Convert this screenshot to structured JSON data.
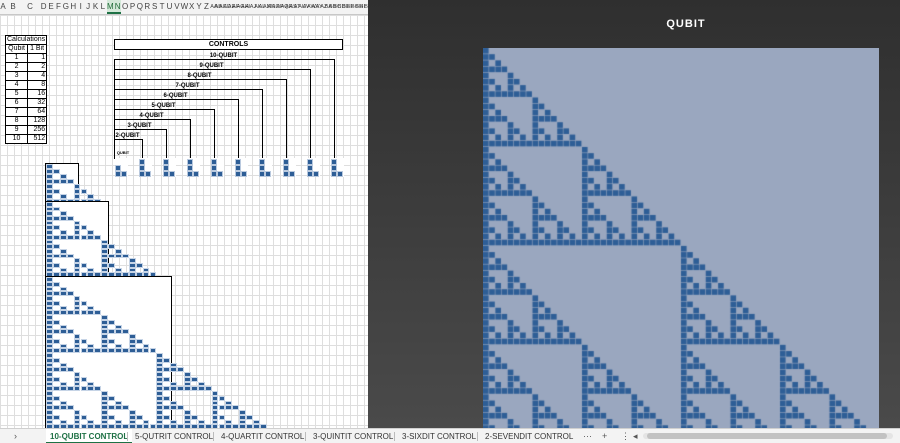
{
  "columns": [
    "A",
    "B",
    "C",
    "D",
    "E",
    "F",
    "G",
    "H",
    "I",
    "J",
    "K",
    "L",
    "M",
    "N",
    "O",
    "P",
    "Q",
    "R",
    "S",
    "T",
    "U",
    "V",
    "W",
    "X",
    "Y",
    "Z",
    "AA",
    "AB",
    "AC",
    "AD",
    "AE",
    "AF",
    "AG",
    "AH",
    "AI",
    "AJ",
    "AK",
    "AL",
    "AM",
    "AN",
    "AO",
    "AP",
    "AQ",
    "AR",
    "AS",
    "AT",
    "AU",
    "AV",
    "AW",
    "AX",
    "AY",
    "AZ",
    "BA",
    "BB",
    "BC",
    "BD",
    "BE",
    "BF",
    "BG",
    "BH",
    "BI",
    "BJ",
    "BK",
    "BL",
    "BM",
    "BN",
    "BO",
    "BP",
    "BQ",
    "BR",
    "BS",
    "BT",
    "BU",
    "BV",
    "BW",
    "BX",
    "BY",
    "BZ",
    "CA",
    "CB",
    "CC",
    "CD",
    "CE",
    "CF",
    "CG",
    "CH",
    "CI",
    "CJ",
    "CK",
    "CL",
    "CM",
    "CN",
    "CO",
    "CP",
    "CQ",
    "CR",
    "CS",
    "CT",
    "CU",
    "CV",
    "CW",
    "CX",
    "CY",
    "CZ",
    "DA",
    "DB",
    "DC",
    "DD",
    "DE",
    "DF",
    "DG",
    "DH",
    "DI"
  ],
  "selected_columns": [
    "M",
    "N"
  ],
  "calculations": {
    "title": "Calculations",
    "col_qubit": "Qubit",
    "col_bit": "1 Bit",
    "rows": [
      {
        "qubit": "1",
        "bit": "1"
      },
      {
        "qubit": "2",
        "bit": "2"
      },
      {
        "qubit": "3",
        "bit": "4"
      },
      {
        "qubit": "4",
        "bit": "8"
      },
      {
        "qubit": "5",
        "bit": "16"
      },
      {
        "qubit": "6",
        "bit": "32"
      },
      {
        "qubit": "7",
        "bit": "64"
      },
      {
        "qubit": "8",
        "bit": "128"
      },
      {
        "qubit": "9",
        "bit": "256"
      },
      {
        "qubit": "10",
        "bit": "512"
      }
    ]
  },
  "controls": {
    "title": "CONTROLS",
    "labels": [
      "10-QUBIT",
      "9-QUBIT",
      "8-QUBIT",
      "7-QUBIT",
      "6-QUBIT",
      "5-QUBIT",
      "4-QUBIT",
      "3-QUBIT",
      "2-QUBIT",
      "QUBIT"
    ]
  },
  "panel": {
    "title": "QUBIT",
    "fill_color": "#9aa7bf",
    "cell_color": "#2e5e96"
  },
  "tabs": [
    {
      "label": "10-QUBIT CONTROL",
      "active": true
    },
    {
      "label": "5-QUTRIT CONTROL",
      "active": false
    },
    {
      "label": "4-QUARTIT CONTROL",
      "active": false
    },
    {
      "label": "3-QUINTIT CONTROL",
      "active": false
    },
    {
      "label": "3-SIXDIT CONTROL",
      "active": false
    },
    {
      "label": "2-SEVENDIT CONTROL",
      "active": false
    }
  ],
  "tab_nav": {
    "prev": "›",
    "more": "···",
    "add": "+",
    "menu": "⋮",
    "scroll_left": "◂"
  }
}
